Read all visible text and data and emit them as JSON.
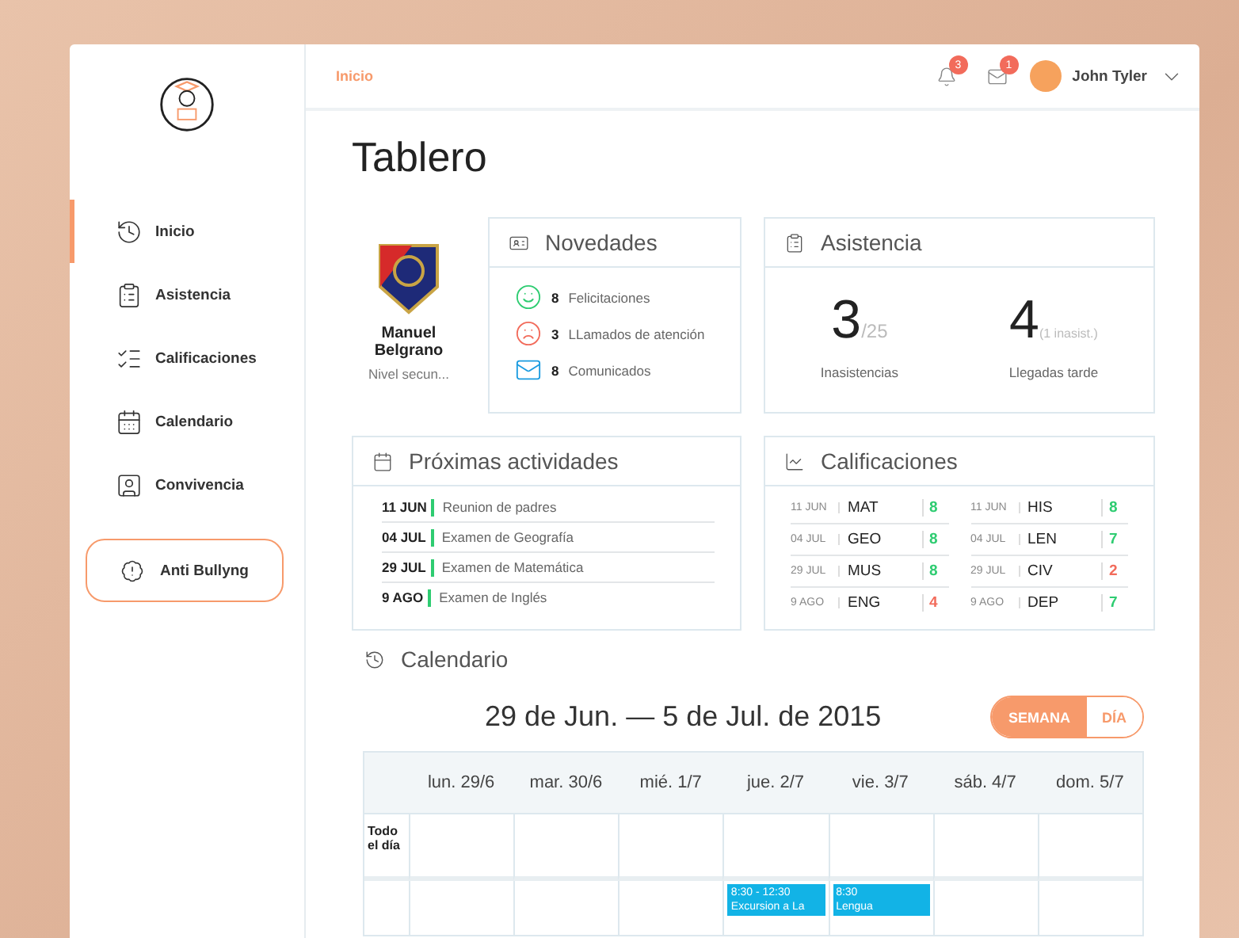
{
  "header": {
    "breadcrumb": "Inicio",
    "notifications_badge": "3",
    "messages_badge": "1",
    "user_name": "John Tyler"
  },
  "sidebar": {
    "items": [
      {
        "label": "Inicio",
        "selected": true
      },
      {
        "label": "Asistencia",
        "selected": false
      },
      {
        "label": "Calificaciones",
        "selected": false
      },
      {
        "label": "Calendario",
        "selected": false
      },
      {
        "label": "Convivencia",
        "selected": false
      }
    ],
    "alert_button": "Anti Bullyng"
  },
  "page_title": "Tablero",
  "student": {
    "name": "Manuel Belgrano",
    "level": "Nivel secun..."
  },
  "novedades": {
    "title": "Novedades",
    "items": [
      {
        "kind": "happy",
        "count": "8",
        "label": "Felicitaciones"
      },
      {
        "kind": "sad",
        "count": "3",
        "label": "LLamados de atención"
      },
      {
        "kind": "mail",
        "count": "8",
        "label": "Comunicados"
      }
    ]
  },
  "asistencia": {
    "title": "Asistencia",
    "stats": [
      {
        "value": "3",
        "suffix": "/25",
        "label": "Inasistencias"
      },
      {
        "value": "4",
        "suffix": "(1 inasist.)",
        "label": "Llegadas tarde"
      }
    ]
  },
  "actividades": {
    "title": "Próximas actividades",
    "items": [
      {
        "date": "11 JUN",
        "text": "Reunion de padres"
      },
      {
        "date": "04 JUL",
        "text": "Examen de Geografía"
      },
      {
        "date": "29 JUL",
        "text": "Examen de Matemática"
      },
      {
        "date": "9 AGO",
        "text": "Examen de Inglés"
      }
    ]
  },
  "calificaciones": {
    "title": "Calificaciones",
    "columns": [
      [
        {
          "date": "11 JUN",
          "subject": "MAT",
          "grade": "8",
          "color": "#2ecc71"
        },
        {
          "date": "04 JUL",
          "subject": "GEO",
          "grade": "8",
          "color": "#2ecc71"
        },
        {
          "date": "29 JUL",
          "subject": "MUS",
          "grade": "8",
          "color": "#2ecc71"
        },
        {
          "date": "9 AGO",
          "subject": "ENG",
          "grade": "4",
          "color": "#f26b5b"
        }
      ],
      [
        {
          "date": "11 JUN",
          "subject": "HIS",
          "grade": "8",
          "color": "#2ecc71"
        },
        {
          "date": "04 JUL",
          "subject": "LEN",
          "grade": "7",
          "color": "#2ecc71"
        },
        {
          "date": "29 JUL",
          "subject": "CIV",
          "grade": "2",
          "color": "#f26b5b"
        },
        {
          "date": "9 AGO",
          "subject": "DEP",
          "grade": "7",
          "color": "#2ecc71"
        }
      ]
    ]
  },
  "calendario": {
    "title": "Calendario",
    "range": "29 de Jun. — 5 de Jul. de 2015",
    "views": [
      {
        "label": "SEMANA",
        "selected": true
      },
      {
        "label": "DÍA",
        "selected": false
      }
    ],
    "all_day_label": "Todo el día",
    "days": [
      {
        "label": "lun. 29/6"
      },
      {
        "label": "mar. 30/6"
      },
      {
        "label": "mié. 1/7"
      },
      {
        "label": "jue. 2/7",
        "events": [
          {
            "time": "8:30 - 12:30",
            "title": "Excursion a La"
          }
        ]
      },
      {
        "label": "vie. 3/7",
        "events": [
          {
            "time": "8:30",
            "title": "Lengua"
          }
        ]
      },
      {
        "label": "sáb. 4/7"
      },
      {
        "label": "dom. 5/7"
      }
    ]
  }
}
